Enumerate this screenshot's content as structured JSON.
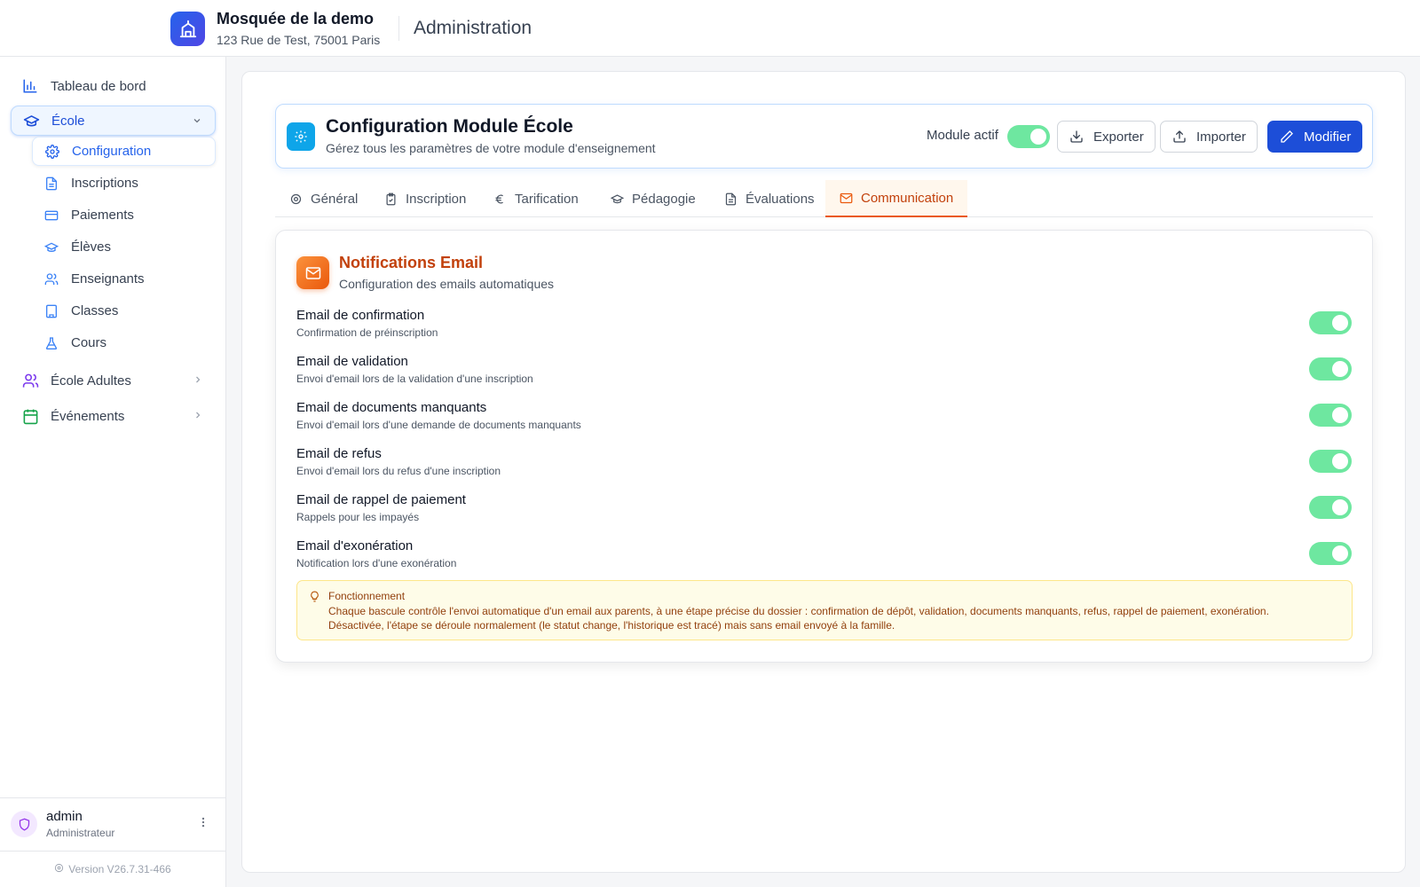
{
  "header": {
    "org_name": "Mosquée de la demo",
    "org_address": "123 Rue de Test, 75001 Paris",
    "section": "Administration"
  },
  "sidebar": {
    "dashboard": "Tableau de bord",
    "ecole": "École",
    "sub_items": [
      "Configuration",
      "Inscriptions",
      "Paiements",
      "Élèves",
      "Enseignants",
      "Classes",
      "Cours"
    ],
    "ecole_adultes": "École Adultes",
    "evenements": "Événements"
  },
  "user": {
    "name": "admin",
    "role": "Administrateur"
  },
  "version": "Version V26.7.31-466",
  "config": {
    "title": "Configuration Module École",
    "subtitle": "Gérez tous les paramètres de votre module d'enseignement",
    "module_label": "Module actif",
    "module_active": true,
    "export_label": "Exporter",
    "import_label": "Importer",
    "edit_label": "Modifier"
  },
  "tabs": [
    "Général",
    "Inscription",
    "Tarification",
    "Pédagogie",
    "Évaluations",
    "Communication"
  ],
  "active_tab": "Communication",
  "notifications": {
    "title": "Notifications Email",
    "subtitle": "Configuration des emails automatiques",
    "items": [
      {
        "title": "Email de confirmation",
        "desc": "Confirmation de préinscription",
        "enabled": true
      },
      {
        "title": "Email de validation",
        "desc": "Envoi d'email lors de la validation d'une inscription",
        "enabled": true
      },
      {
        "title": "Email de documents manquants",
        "desc": "Envoi d'email lors d'une demande de documents manquants",
        "enabled": true
      },
      {
        "title": "Email de refus",
        "desc": "Envoi d'email lors du refus d'une inscription",
        "enabled": true
      },
      {
        "title": "Email de rappel de paiement",
        "desc": "Rappels pour les impayés",
        "enabled": true
      },
      {
        "title": "Email d'exonération",
        "desc": "Notification lors d'une exonération",
        "enabled": true
      }
    ],
    "info_title": "Fonctionnement",
    "info_line1": "Chaque bascule contrôle l'envoi automatique d'un email aux parents, à une étape précise du dossier : confirmation de dépôt, validation, documents manquants, refus, rappel de paiement, exonération.",
    "info_line2": "Désactivée, l'étape se déroule normalement (le statut change, l'historique est tracé) mais sans email envoyé à la famille."
  },
  "colors": {
    "accent": "#1d4ed8",
    "orange": "#ea580c",
    "toggle_on": "#6ee7a0"
  }
}
